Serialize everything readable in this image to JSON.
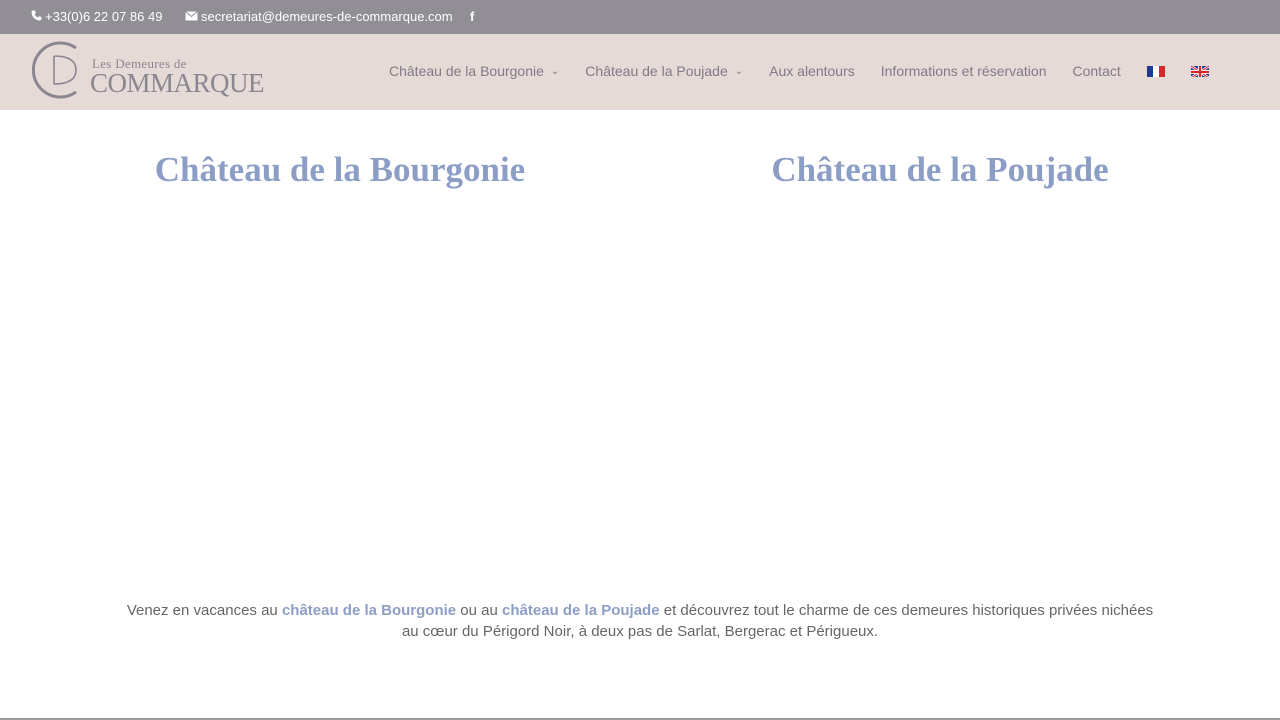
{
  "topbar": {
    "phone": "+33(0)6 22 07 86 49",
    "email": "secretariat@demeures-de-commarque.com",
    "facebook_glyph": "f",
    "background": "#918e96"
  },
  "header": {
    "logo_small": "Les Demeures de",
    "logo_big": "COMMARQUE",
    "logo_monogram": "CD",
    "background": "#e6dad6"
  },
  "nav": {
    "items": [
      {
        "label": "Château de la Bourgonie",
        "has_dropdown": true
      },
      {
        "label": "Château de la Poujade",
        "has_dropdown": true
      },
      {
        "label": "Aux alentours",
        "has_dropdown": false
      },
      {
        "label": "Informations et réservation",
        "has_dropdown": false
      },
      {
        "label": "Contact",
        "has_dropdown": false
      }
    ],
    "languages": [
      "fr-flag-icon",
      "en-flag-icon"
    ]
  },
  "main": {
    "title_left": "Château de la Bourgonie",
    "title_right": "Château de la Poujade",
    "accent": "#8d9ec6"
  },
  "intro": {
    "part1": "Venez en vacances au ",
    "link1": "château de la Bourgonie",
    "part2": " ou au ",
    "link2": "château de la Poujade",
    "part3": " et découvrez tout le charme de ces demeures historiques privées nichées au cœur du Périgord Noir, à deux pas de Sarlat, Bergerac et Périgueux."
  }
}
